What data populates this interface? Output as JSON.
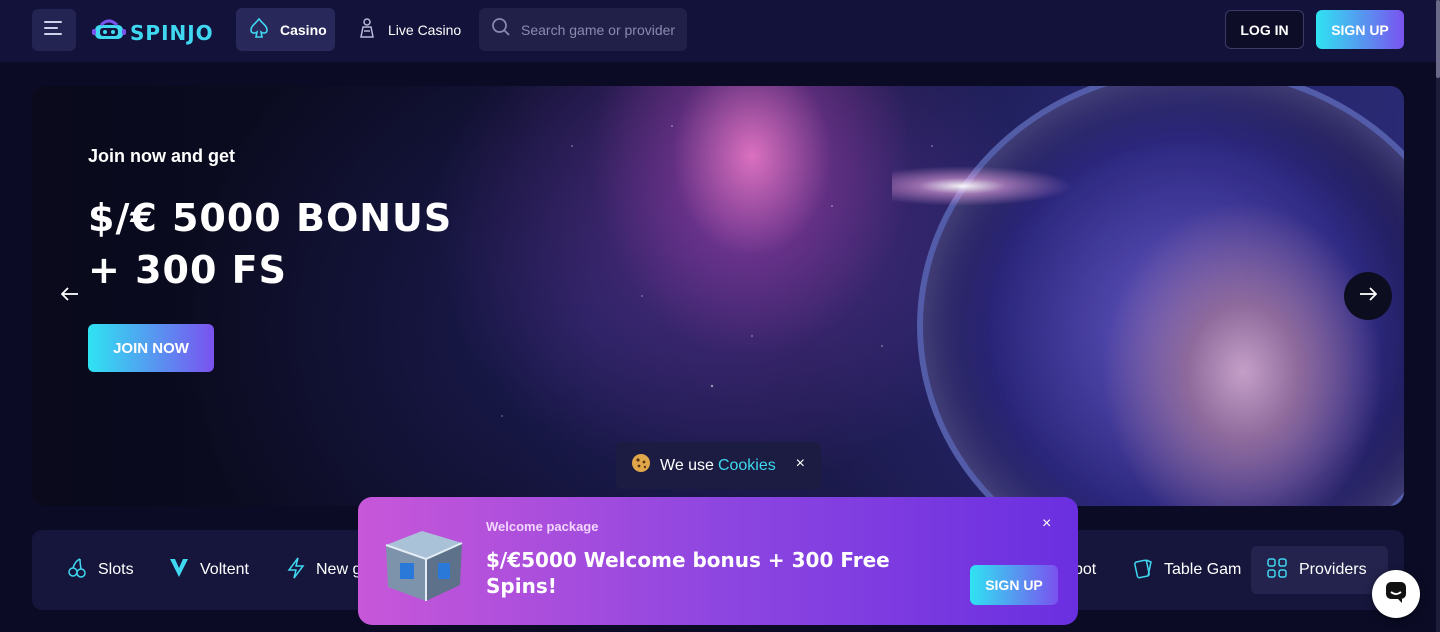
{
  "header": {
    "logo_text": "SPINJO",
    "nav": {
      "casino": "Casino",
      "live_casino": "Live Casino"
    },
    "search": {
      "placeholder": "Search game or provider"
    },
    "login_label": "LOG IN",
    "signup_label": "SIGN UP"
  },
  "hero": {
    "subtitle": "Join now and get",
    "title_line1": "$/€ 5000 BONUS",
    "title_line2": "+ 300 FS",
    "cta_label": "JOIN NOW"
  },
  "cookie": {
    "text": "We use",
    "link": "Cookies",
    "close": "×"
  },
  "categories": {
    "items": [
      {
        "label": "Slots",
        "icon": "cherries-icon"
      },
      {
        "label": "Voltent",
        "icon": "voltent-icon"
      },
      {
        "label": "New g",
        "icon": "lightning-icon"
      },
      {
        "label": "pot",
        "icon": "jackpot-icon"
      },
      {
        "label": "Table Gam",
        "icon": "cards-icon"
      }
    ],
    "providers_label": "Providers"
  },
  "welcome": {
    "label": "Welcome package",
    "title": "$/€5000 Welcome bonus + 300 Free Spins!",
    "signup_label": "SIGN UP",
    "close": "×"
  },
  "colors": {
    "accent_cyan": "#2fe3f2",
    "accent_purple": "#7a52ef",
    "bg": "#0b0b26"
  }
}
